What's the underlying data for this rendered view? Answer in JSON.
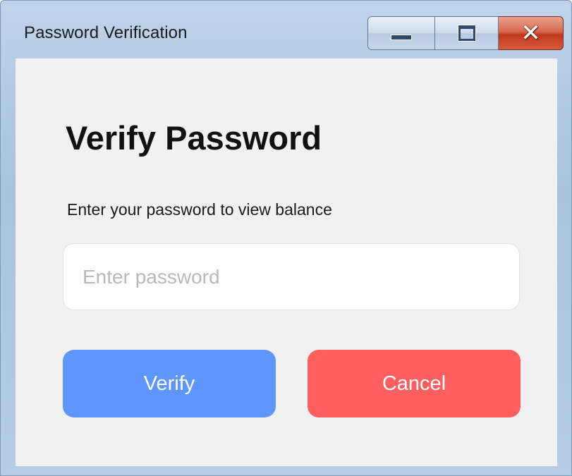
{
  "window": {
    "title": "Password Verification",
    "controls": {
      "minimize_icon": "minimize-icon",
      "maximize_icon": "maximize-icon",
      "close_icon": "close-icon",
      "close_glyph": "✕"
    }
  },
  "dialog": {
    "heading": "Verify Password",
    "subtitle": "Enter your password to view balance",
    "password_field": {
      "value": "",
      "placeholder": "Enter password"
    },
    "buttons": {
      "verify_label": "Verify",
      "cancel_label": "Cancel"
    }
  },
  "colors": {
    "verify_button": "#5e96fb",
    "cancel_button": "#fd5e5e",
    "client_background": "#f1f1f1",
    "titlebar": "#b3c9e3"
  }
}
